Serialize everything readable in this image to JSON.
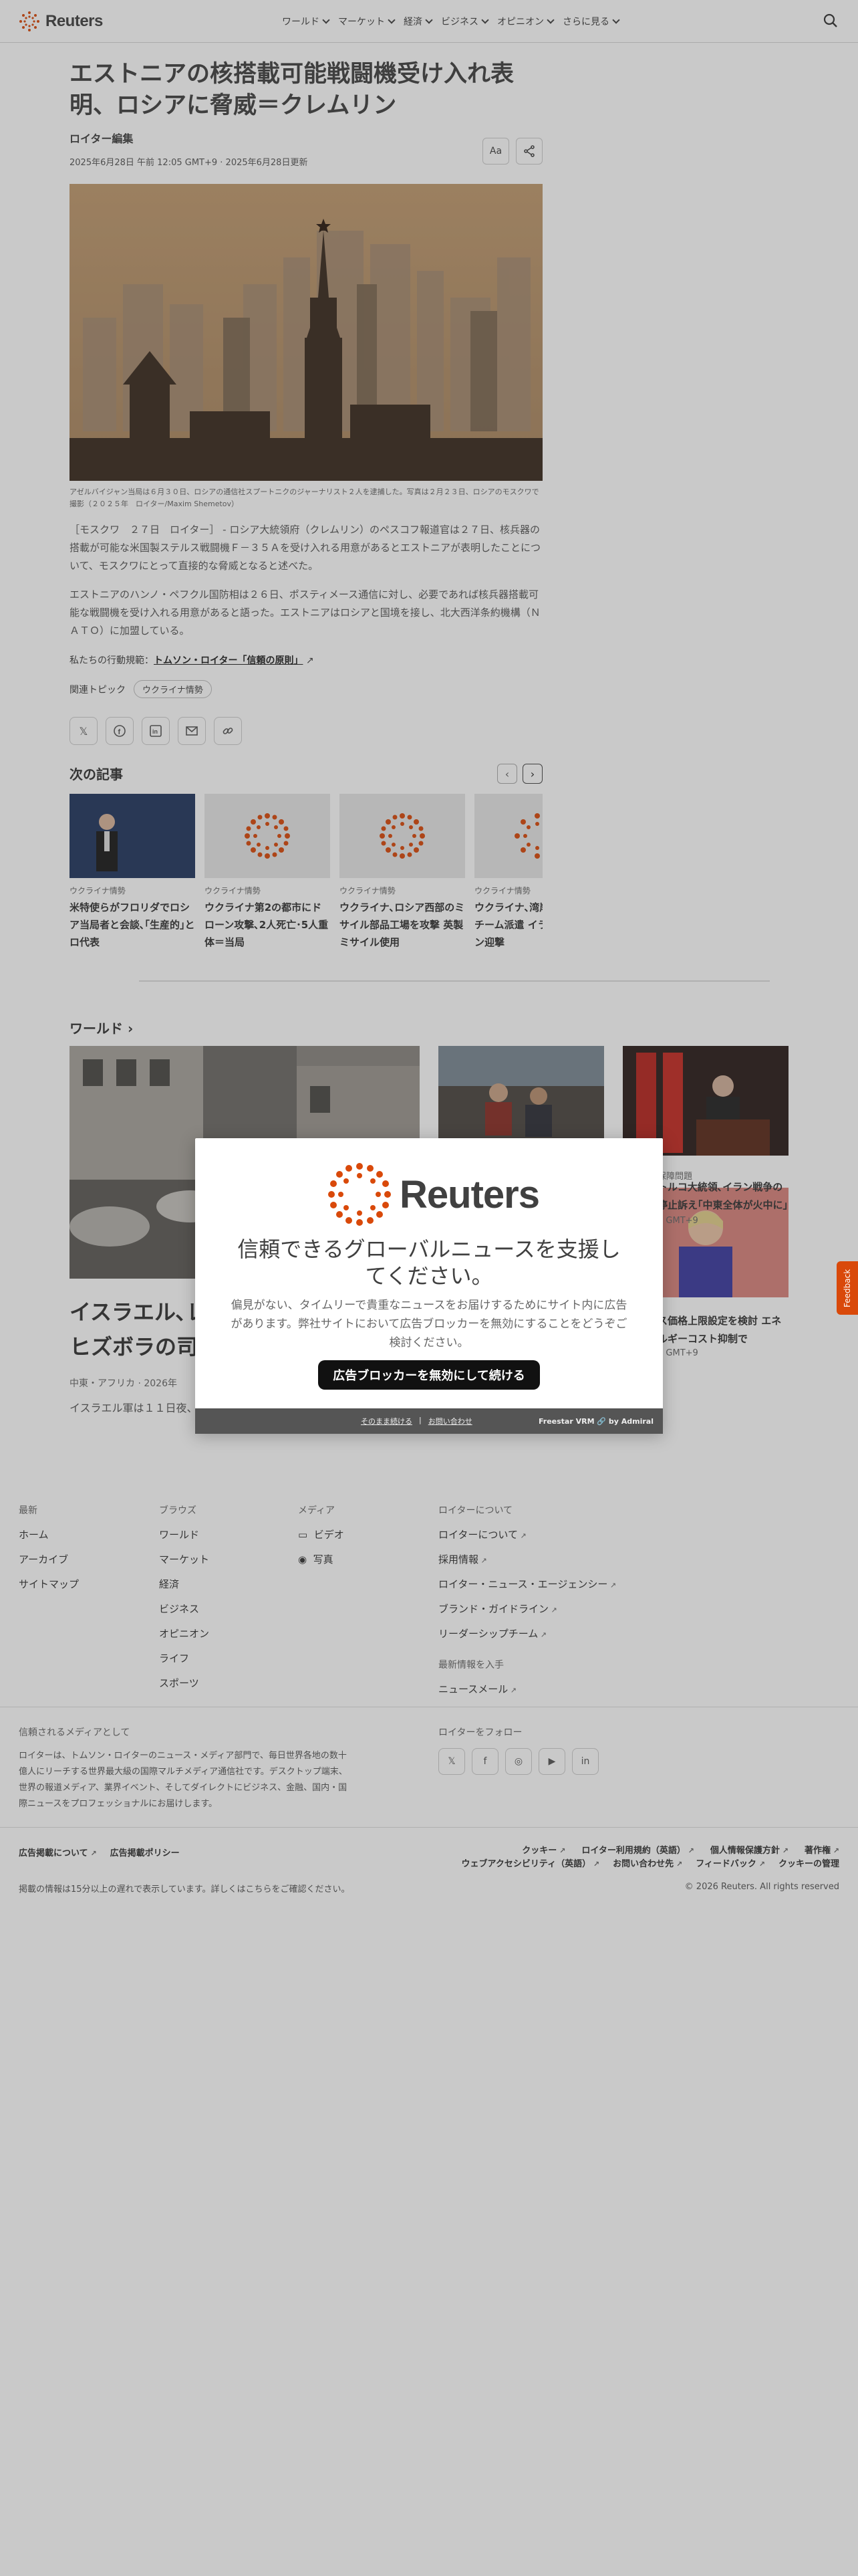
{
  "header": {
    "brand": "Reuters",
    "nav": [
      "ワールド",
      "マーケット",
      "経済",
      "ビジネス",
      "オピニオン",
      "さらに見る"
    ]
  },
  "article": {
    "title": "エストニアの核搭載可能戦闘機受け入れ表明、ロシアに脅威＝クレムリン",
    "byline": "ロイター編集",
    "date": "2025年6月28日 午前 12:05 GMT+9 · 2025年6月28日更新",
    "font_button": "Aa",
    "caption": "アゼルバイジャン当局は６月３０日、ロシアの通信社スプートニクのジャーナリスト２人を逮捕した。写真は２月２３日、ロシアのモスクワで撮影（２０２５年　ロイター/Maxim Shemetov）",
    "paragraphs": [
      "［モスクワ　２７日　ロイター］ - ロシア大統領府（クレムリン）のペスコフ報道官は２７日、核兵器の搭載が可能な米国製ステルス戦闘機Ｆ－３５Ａを受け入れる用意があるとエストニアが表明したことについて、モスクワにとって直接的な脅威となると述べた。",
      "エストニアのハンノ・ペフクル国防相は２６日、ポスティメース通信に対し、必要であれば核兵器搭載可能な戦闘機を受け入れる用意があると語った。エストニアはロシアと国境を接し、北大西洋条約機構（ＮＡＴＯ）に加盟している。"
    ],
    "principles_prefix": "私たちの行動規範：",
    "principles_link": "トムソン・ロイター「信頼の原則」",
    "topics_label": "関連トピック",
    "topic": "ウクライナ情勢"
  },
  "next": {
    "heading": "次の記事",
    "cards": [
      {
        "tag": "ウクライナ情勢",
        "title": "米特使らがフロリダでロシア当局者と会談､｢生産的｣とロ代表"
      },
      {
        "tag": "ウクライナ情勢",
        "title": "ウクライナ第2の都市にドローン攻撃､2人死亡･5人重体＝当局"
      },
      {
        "tag": "ウクライナ情勢",
        "title": "ウクライナ､ロシア西部のミサイル部品工場を攻撃 英製ミサイル使用"
      },
      {
        "tag": "ウクライナ情勢",
        "title": "ウクライナ､湾岸諸国に防空チーム派遣 イランのドローン迎撃"
      }
    ]
  },
  "world": {
    "heading": "ワールド",
    "lead_title": "イスラエル､レバノンの首都を空爆　ヒズボラの司令官を標的",
    "lead_meta": "中東・アフリカ · 2026年",
    "lead_text": "イスラエル軍は１１日夜、…を空爆し、…の施設を破壊した。",
    "side_tag": "保障問題",
    "side_title": "トルコ大統領､イラン戦争の停止訴え｢中東全体が火中に｣",
    "side_time": "1 GMT+9",
    "side2_title": "ス価格上限設定を検討 エネルギーコスト抑制で",
    "side2_time": "3 GMT+9"
  },
  "modal": {
    "brand": "Reuters",
    "heading": "信頼できるグローバルニュースを支援してください。",
    "body": "偏見がない、タイムリーで貴重なニュースをお届けするためにサイト内に広告があります。弊社サイトにおいて広告ブロッカーを無効にすることをどうぞご検討ください。",
    "button": "広告ブロッカーを無効にして続ける",
    "continue": "そのまま続ける",
    "contact": "お問い合わせ",
    "provider": "Freestar VRM 🔗 by Admiral"
  },
  "feedback": "Feedback",
  "footer": {
    "col1": {
      "heading": "最新",
      "links": [
        "ホーム",
        "アーカイブ",
        "サイトマップ"
      ]
    },
    "col2": {
      "heading": "ブラウズ",
      "links": [
        "ワールド",
        "マーケット",
        "経済",
        "ビジネス",
        "オピニオン",
        "ライフ",
        "スポーツ"
      ]
    },
    "col3": {
      "heading": "メディア",
      "links": [
        "ビデオ",
        "写真"
      ]
    },
    "col4": {
      "heading": "ロイターについて",
      "links": [
        "ロイターについて",
        "採用情報",
        "ロイター・ニュース・エージェンシー",
        "ブランド・ガイドライン",
        "リーダーシップチーム"
      ],
      "sub_heading": "最新情報を入手",
      "sub_link": "ニュースメール"
    },
    "trusted_heading": "信頼されるメディアとして",
    "trusted_text": "ロイターは、トムソン・ロイターのニュース・メディア部門で、毎日世界各地の数十億人にリーチする世界最大級の国際マルチメディア通信社です。デスクトップ端末、世界の報道メディア、業界イベント、そしてダイレクトにビジネス、金融、国内・国際ニュースをプロフェッショナルにお届けします。",
    "follow_heading": "ロイターをフォロー",
    "ad_links": [
      "広告掲載について",
      "広告掲載ポリシー"
    ],
    "legal_links_row1": [
      "クッキー",
      "ロイター利用規約（英語）",
      "個人情報保護方針",
      "著作権"
    ],
    "legal_links_row2": [
      "ウェブアクセシビリティ（英語）",
      "お問い合わせ先",
      "フィードバック",
      "クッキーの管理"
    ],
    "delay_note": "掲載の情報は15分以上の遅れで表示しています。詳しくはこちらをご確認ください。",
    "copyright": "© 2026 Reuters. All rights reserved"
  }
}
